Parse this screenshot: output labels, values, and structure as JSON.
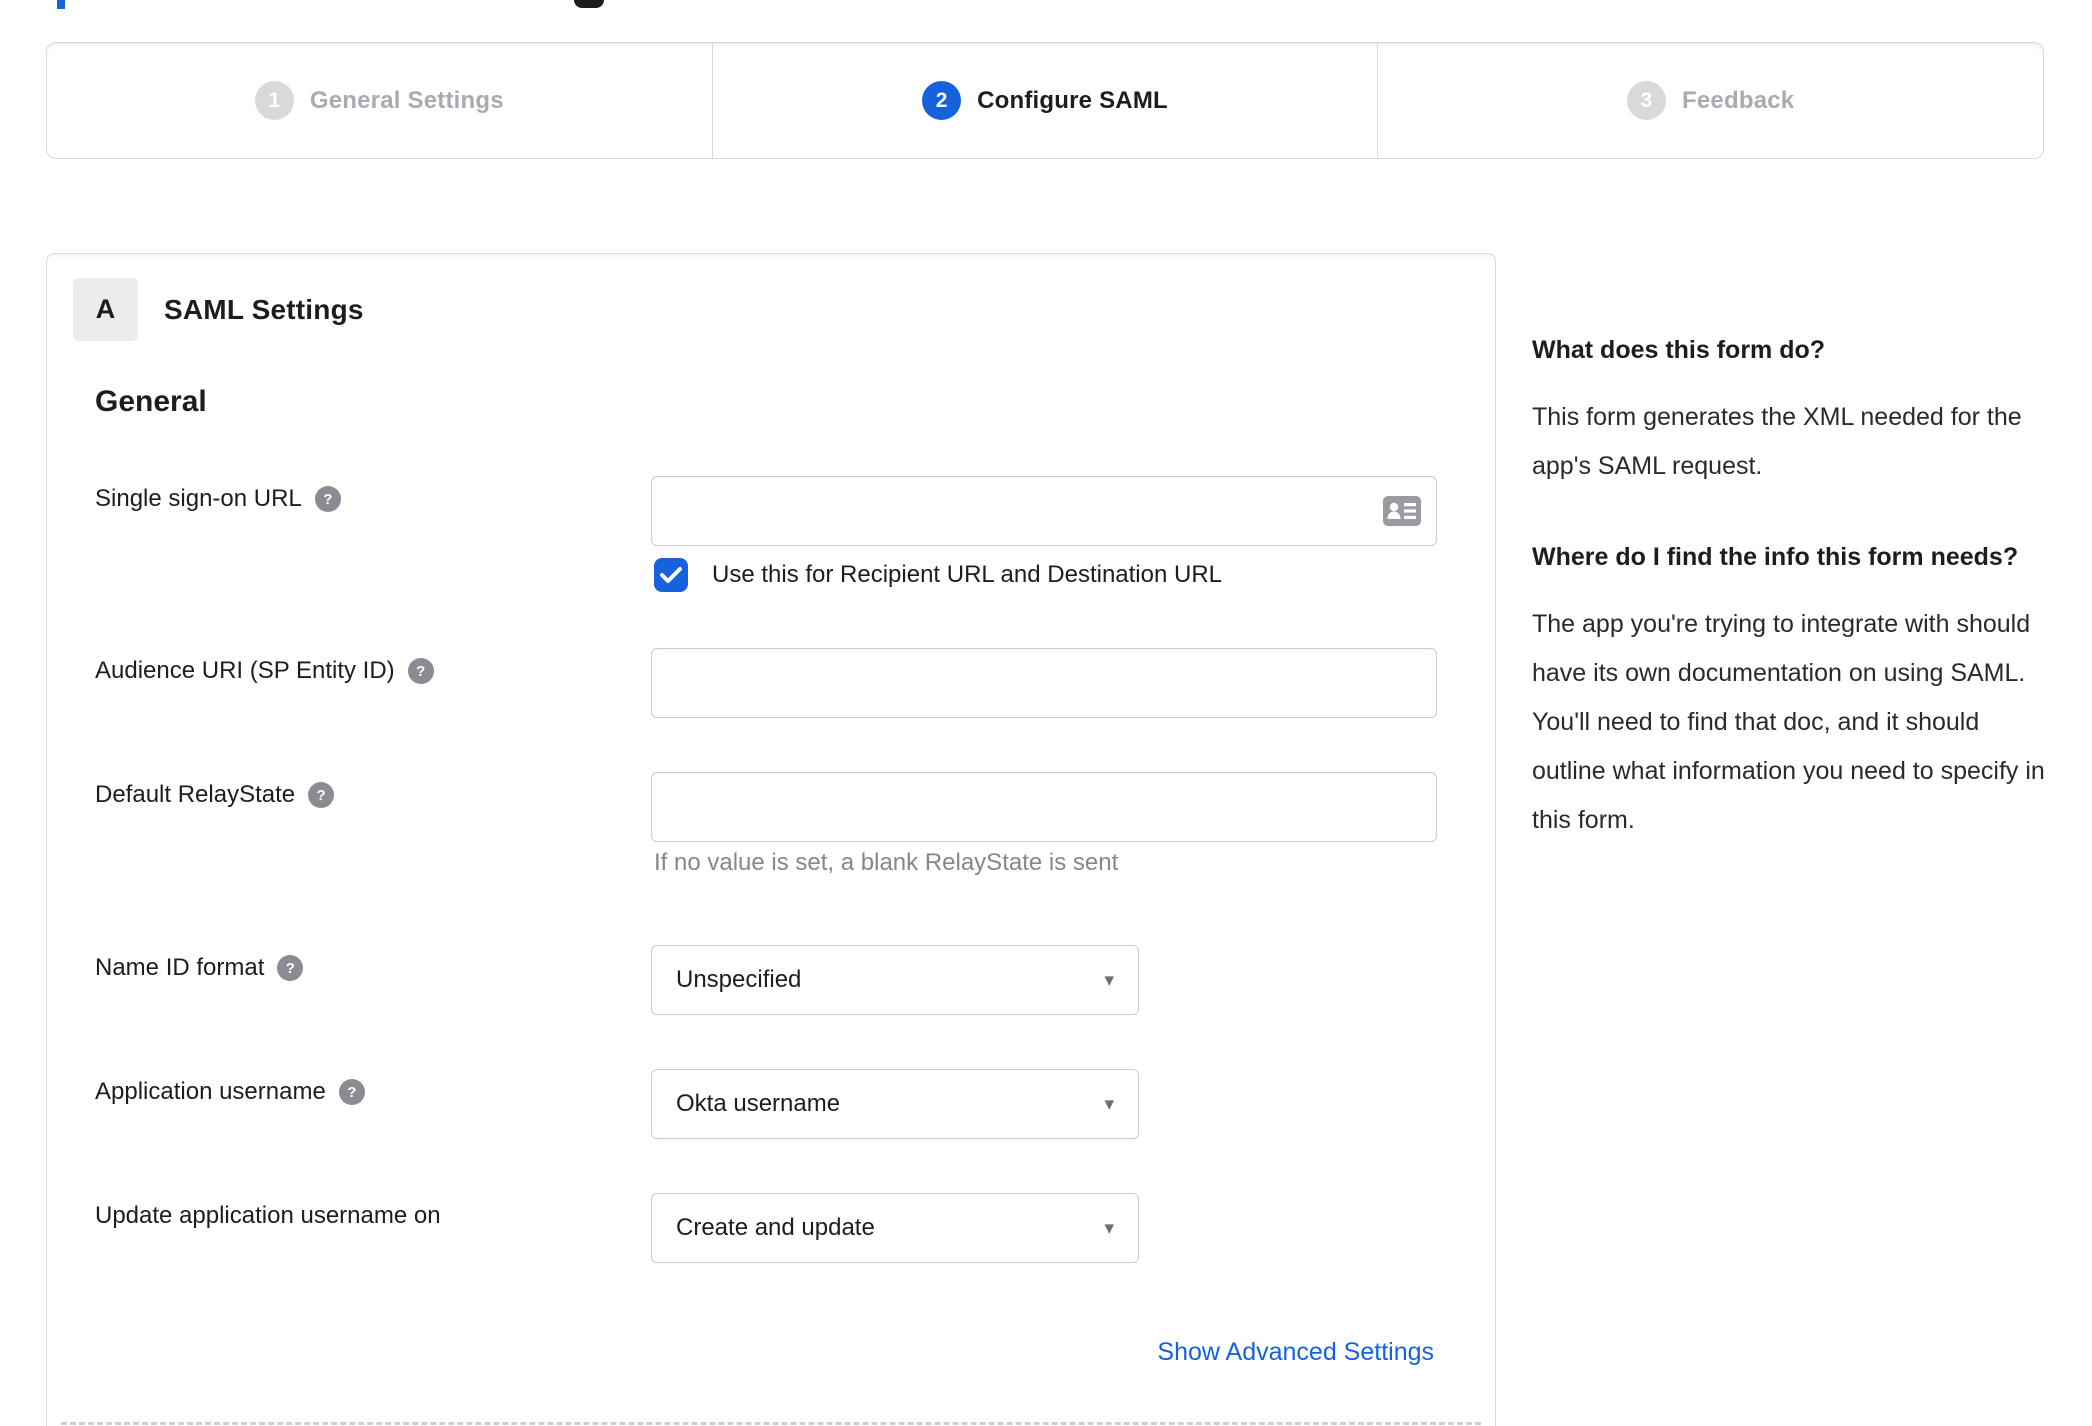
{
  "colors": {
    "accent": "#1662dd",
    "text": "#1d1d21",
    "inactive_step": "#a9abb0",
    "border": "#d9d9dc",
    "help_icon_bg": "#8b8b93",
    "hint_text": "#86868c",
    "link": "#1662dd"
  },
  "icons": {
    "help_glyph": "?",
    "caret_glyph": "▾"
  },
  "wizard": {
    "steps": [
      {
        "number": "1",
        "label": "General Settings"
      },
      {
        "number": "2",
        "label": "Configure SAML"
      },
      {
        "number": "3",
        "label": "Feedback"
      }
    ],
    "active_step": "Configure SAML"
  },
  "panel": {
    "badge": "A",
    "title": "SAML Settings",
    "group": "General",
    "fields": {
      "sso": {
        "label": "Single sign-on URL",
        "value": "",
        "checkbox_label": "Use this for Recipient URL and Destination URL",
        "checked": true
      },
      "audience": {
        "label": "Audience URI (SP Entity ID)",
        "value": ""
      },
      "relay": {
        "label": "Default RelayState",
        "value": "",
        "hint": "If no value is set, a blank RelayState is sent"
      },
      "name_id": {
        "label": "Name ID format",
        "value": "Unspecified"
      },
      "app_username": {
        "label": "Application username",
        "value": "Okta username"
      },
      "update_username": {
        "label": "Update application username on",
        "value": "Create and update"
      }
    },
    "advanced_link": "Show Advanced Settings"
  },
  "sidebar": {
    "q1": "What does this form do?",
    "a1": "This form generates the XML needed for the app's SAML request.",
    "q2": "Where do I find the info this form needs?",
    "a2": "The app you're trying to integrate with should have its own documentation on using SAML. You'll need to find that doc, and it should outline what information you need to specify in this form."
  }
}
